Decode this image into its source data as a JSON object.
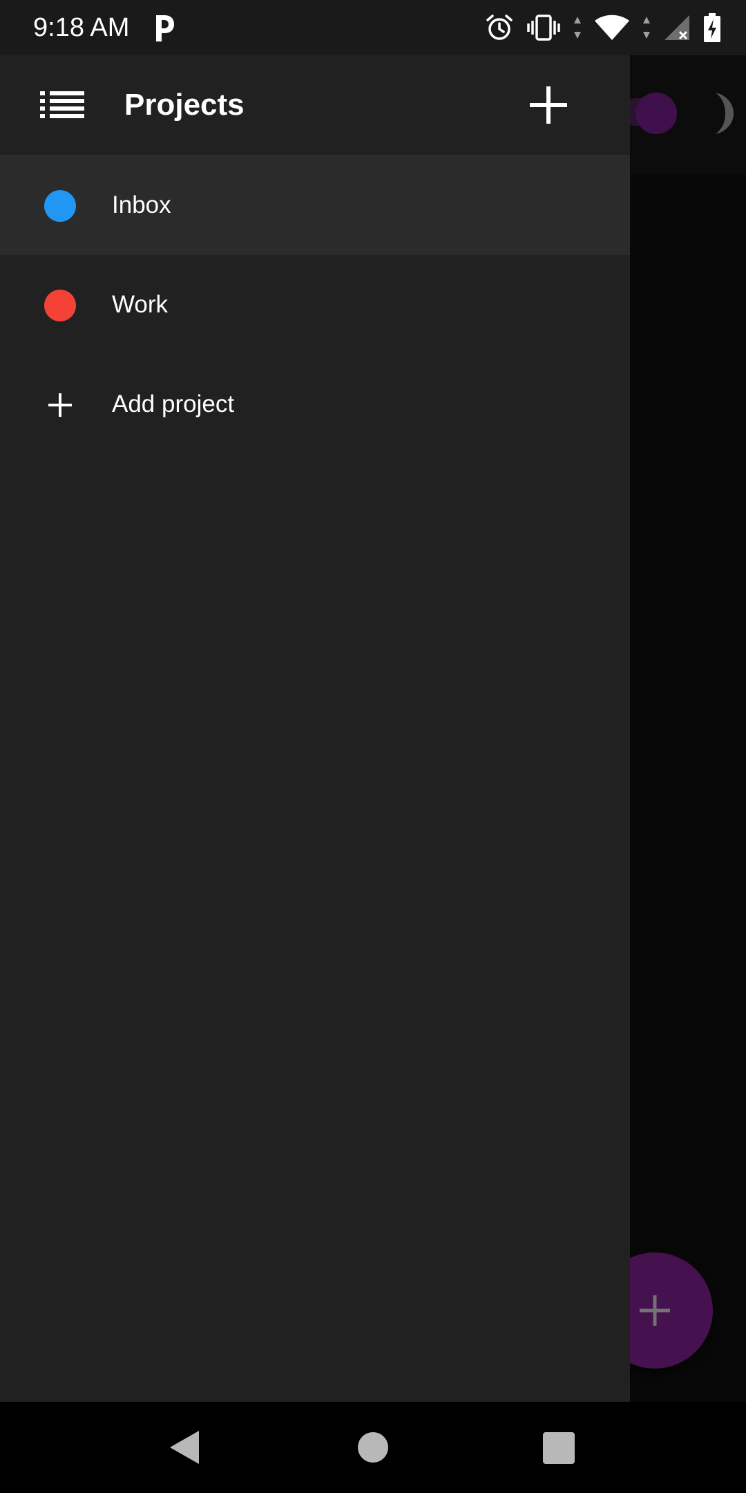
{
  "status_bar": {
    "time": "9:18 AM",
    "icons": [
      "parking-app-icon",
      "alarm-icon",
      "vibrate-icon",
      "wifi-icon",
      "cellular-no-signal-icon",
      "battery-charging-icon"
    ]
  },
  "drawer": {
    "title": "Projects",
    "menu_icon": "list-icon",
    "add_icon": "plus-icon",
    "projects": [
      {
        "label": "Inbox",
        "color": "#2196F3",
        "selected": true
      },
      {
        "label": "Work",
        "color": "#F44336",
        "selected": false
      }
    ],
    "add_project_label": "Add project"
  },
  "background_app": {
    "theme_toggle_color": "#8E24AA",
    "theme_icon": "moon-icon",
    "fab_color": "#9C27B0",
    "fab_icon": "plus-icon"
  },
  "nav_bar": {
    "buttons": [
      "back-icon",
      "home-icon",
      "recents-icon"
    ]
  }
}
